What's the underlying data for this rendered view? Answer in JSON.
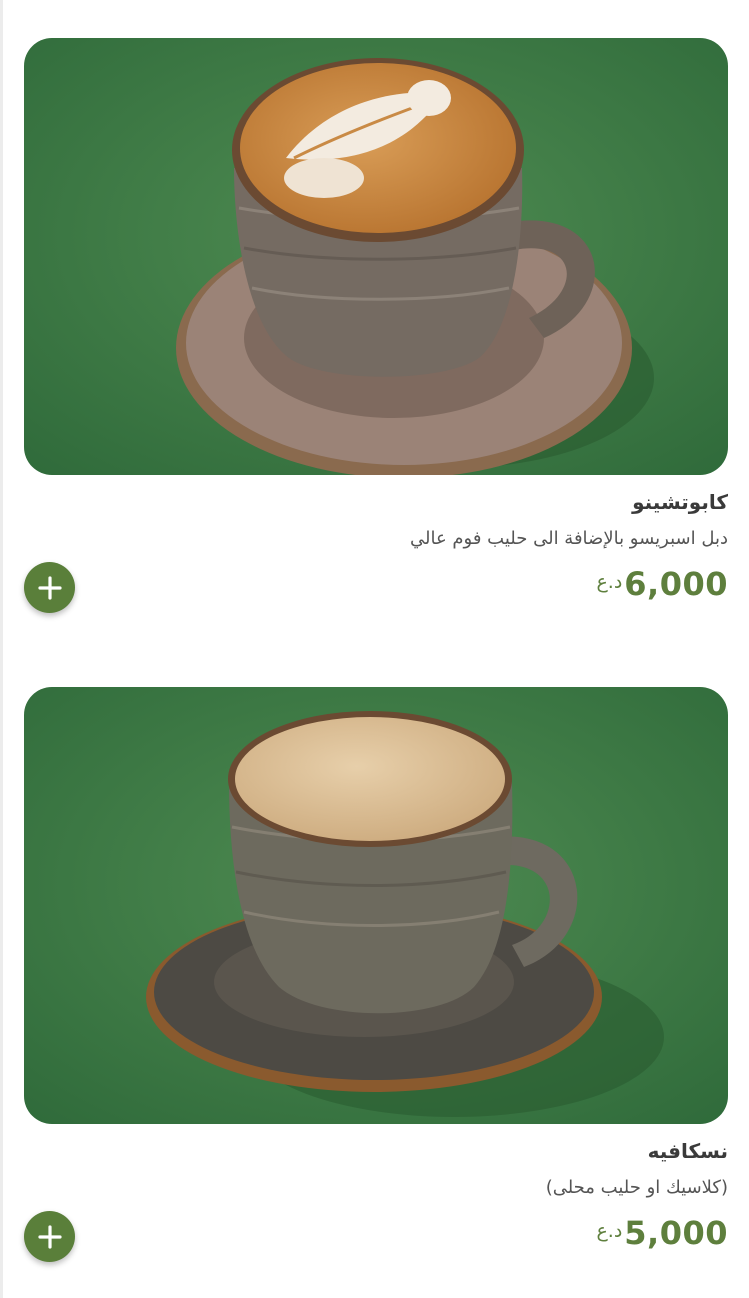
{
  "colors": {
    "accent": "#5e7f3d",
    "button": "#5a7f3a",
    "photo_background": "#44824a"
  },
  "icons": {
    "add": "plus-icon"
  },
  "items": [
    {
      "name": "كابوتشينو",
      "description": "دبل اسبريسو بالإضافة الى حليب فوم عالي",
      "price": "6,000",
      "currency": "د.ع",
      "photo": "cappuccino-with-latte-art-image"
    },
    {
      "name": "نسكافيه",
      "description": "(كلاسيك او حليب محلى)",
      "price": "5,000",
      "currency": "د.ع",
      "photo": "nescafe-cup-image"
    }
  ]
}
